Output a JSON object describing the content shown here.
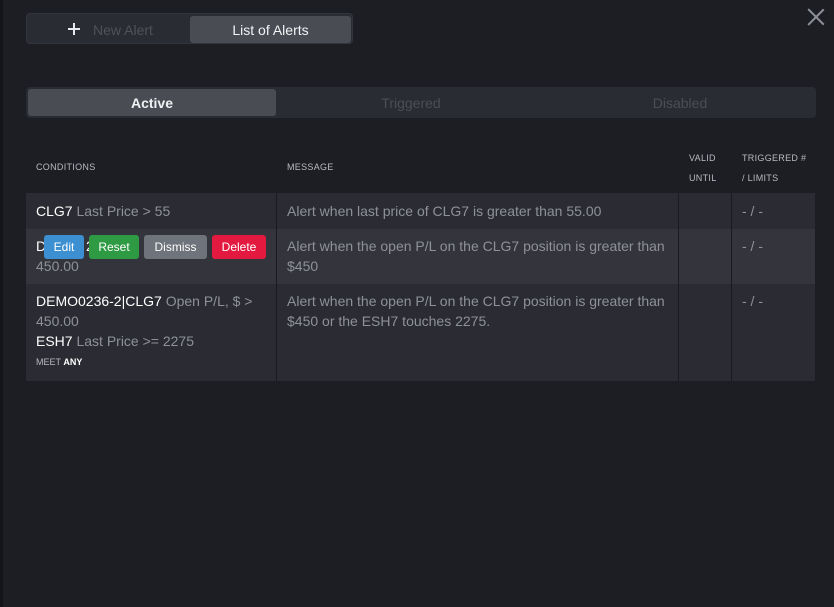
{
  "header": {
    "new_alert_label": "New Alert",
    "list_of_alerts_label": "List of Alerts"
  },
  "tabs": {
    "active": "Active",
    "triggered": "Triggered",
    "disabled": "Disabled"
  },
  "table": {
    "columns": {
      "conditions": "CONDITIONS",
      "message": "MESSAGE",
      "valid_until_1": "VALID",
      "valid_until_2": "UNTIL",
      "triggered_1": "TRIGGERED #",
      "triggered_2": "/ LIMITS"
    },
    "rows": [
      {
        "symbol": "CLG7",
        "condition": " Last Price > 55",
        "message": "Alert when last price of CLG7 is greater than 55.00",
        "valid_until": "",
        "limits": "- / -"
      },
      {
        "symbol_partial_1": "D",
        "symbol_partial_2": "2",
        "symbol_partial_3": "G",
        "condition_line2": "450.00",
        "message_line1": "Alert when the open P/L on the CLG7 position is greater than",
        "message_line2": "$450",
        "valid_until": "",
        "limits": "- / -",
        "actions": {
          "edit": "Edit",
          "reset": "Reset",
          "dismiss": "Dismiss",
          "delete": "Delete"
        }
      },
      {
        "symbol": "DEMO0236-2|CLG7",
        "condition_line1": " Open P/L, $ >",
        "condition_line2": "450.00",
        "symbol2": "ESH7",
        "condition2": " Last Price >= 2275",
        "meet_label": "MEET ",
        "meet_value": "ANY",
        "message_line1": "Alert when the open P/L on the CLG7 position is greater than",
        "message_line2": "$450 or the ESH7 touches 2275.",
        "valid_until": "",
        "limits": "- / -"
      }
    ]
  },
  "colors": {
    "edit": "#3c8fd0",
    "reset": "#2f9a44",
    "dismiss": "#6f737b",
    "delete": "#e3193f"
  }
}
